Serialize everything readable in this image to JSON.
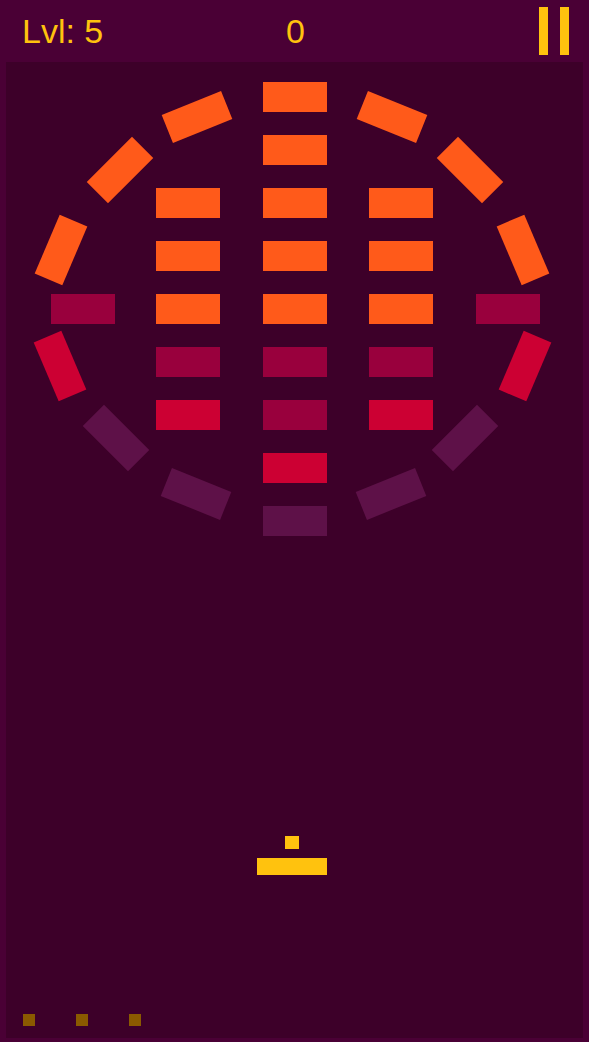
{
  "header": {
    "level": "Lvl: 5",
    "score": "0"
  },
  "bricks": [
    {
      "color": "#ff5a1a"
    },
    {
      "color": "#ff5a1a"
    },
    {
      "color": "#ff5a1a"
    },
    {
      "color": "#ff5a1a"
    },
    {
      "color": "#ff5a1a"
    },
    {
      "color": "#99003d"
    },
    {
      "color": "#99003d"
    },
    {
      "color": "#cc0033"
    },
    {
      "color": "#5e1148"
    },
    {
      "color": "#ff5a1a"
    },
    {
      "color": "#ff5a1a"
    },
    {
      "color": "#ff5a1a"
    },
    {
      "color": "#99003d"
    },
    {
      "color": "#cc0033"
    },
    {
      "color": "#ff5a1a"
    },
    {
      "color": "#ff5a1a"
    },
    {
      "color": "#ff5a1a"
    },
    {
      "color": "#99003d"
    },
    {
      "color": "#cc0033"
    },
    {
      "color": "#ff5a1a"
    },
    {
      "color": "#ff5a1a"
    },
    {
      "color": "#ff5a1a"
    },
    {
      "color": "#99003d"
    },
    {
      "color": "#cc0033"
    },
    {
      "color": "#5e1148"
    },
    {
      "color": "#5e1148"
    },
    {
      "color": "#ff5a1a"
    },
    {
      "color": "#ff5a1a"
    },
    {
      "color": "#ff5a1a"
    },
    {
      "color": "#99003d"
    },
    {
      "color": "#cc0033"
    },
    {
      "color": "#5e1148"
    },
    {
      "color": "#5e1148"
    }
  ],
  "lives": [
    {
      "available": true
    },
    {
      "available": true
    },
    {
      "available": true
    }
  ]
}
